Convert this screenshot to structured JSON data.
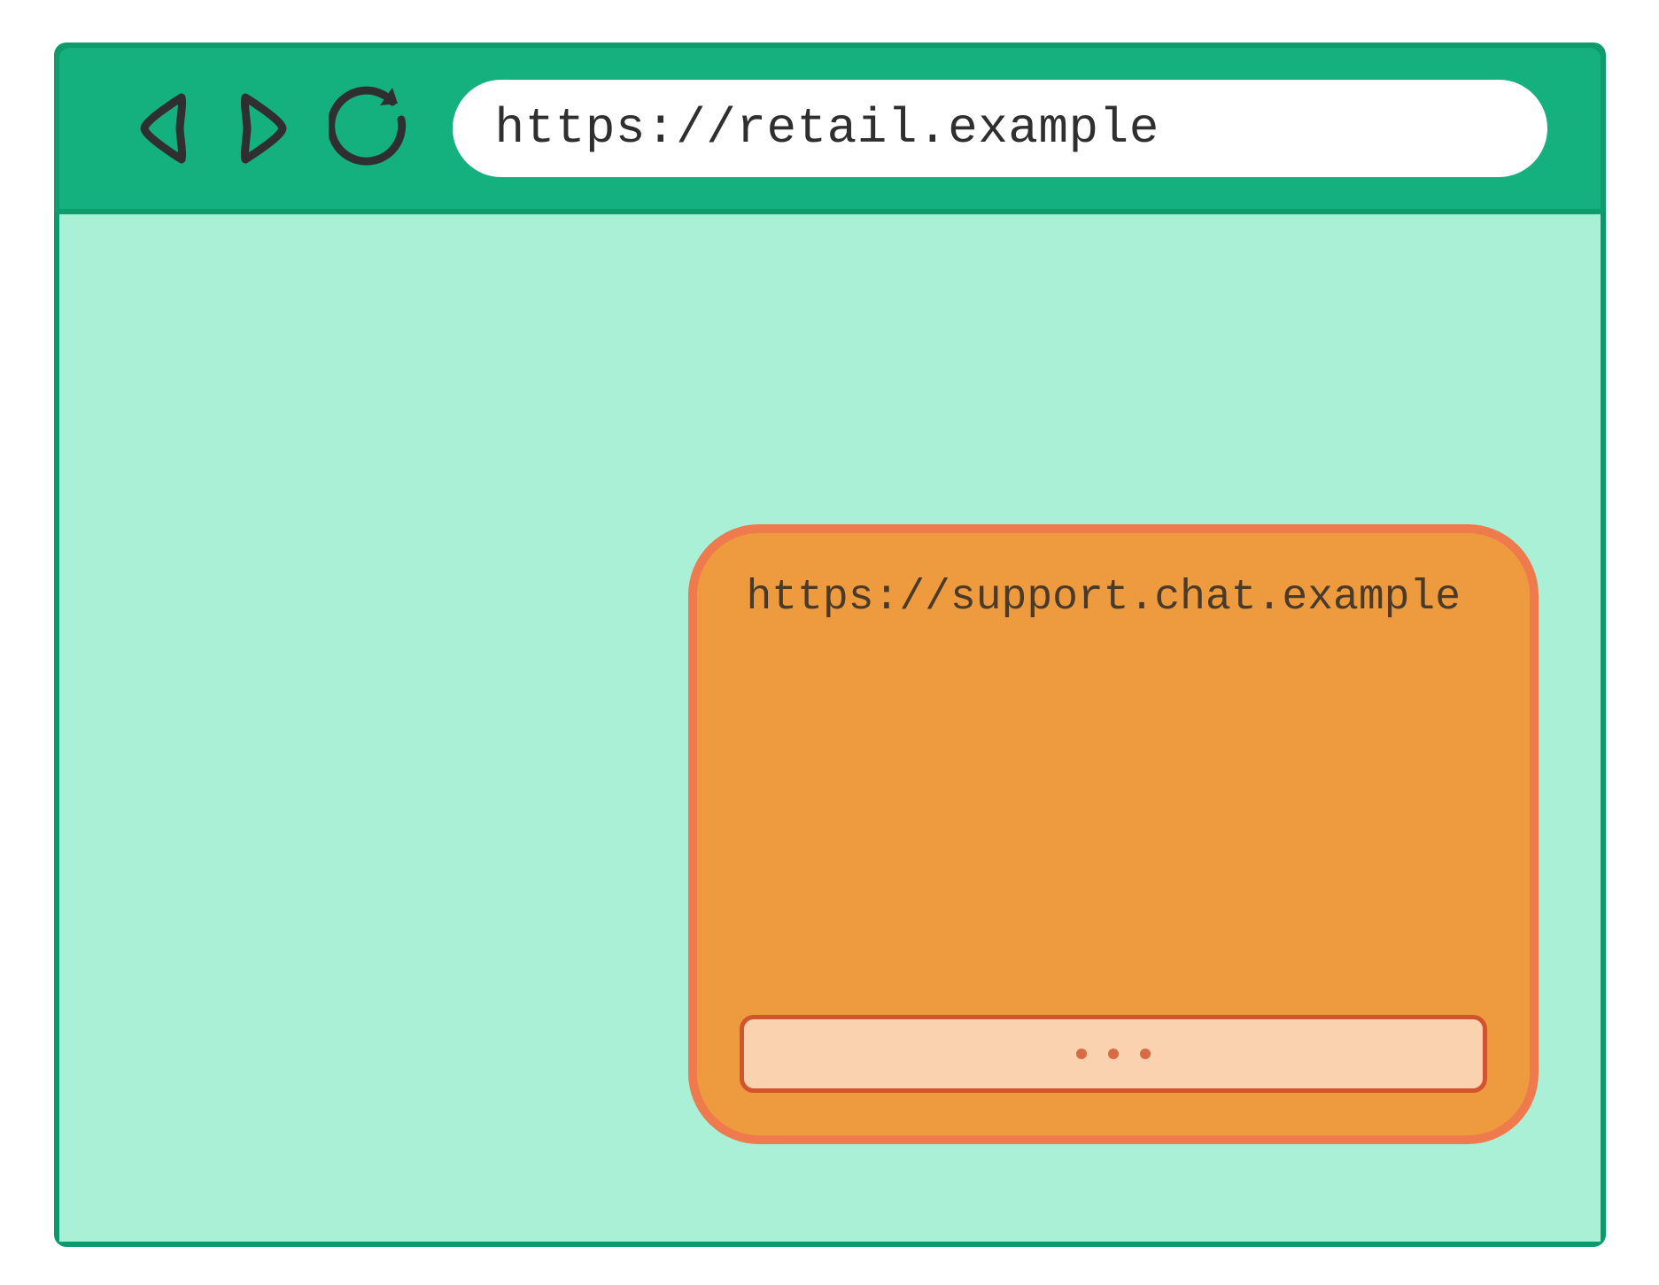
{
  "browser": {
    "url": "https://retail.example"
  },
  "iframe": {
    "origin": "https://support.chat.example"
  }
}
